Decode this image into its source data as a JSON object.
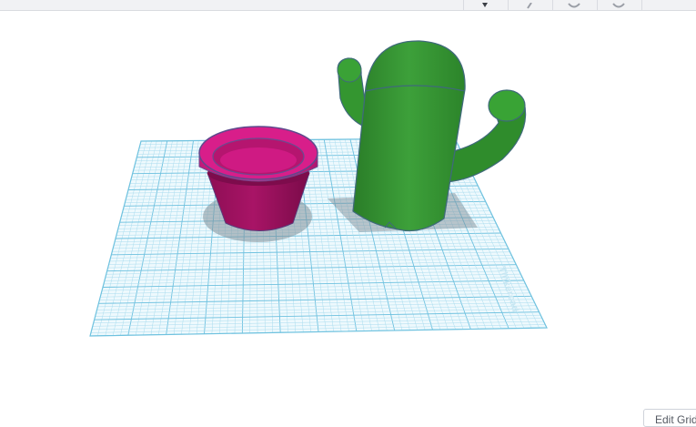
{
  "toolbar": {
    "icons": [
      "pin-icon",
      "slash-tool-icon",
      "rotate-left-icon",
      "rotate-right-icon"
    ]
  },
  "workplane": {
    "watermark": "Tinkercad",
    "grid_color": "#8fd3ea",
    "plane_color": "#e9f7fc"
  },
  "objects": [
    {
      "name": "flower-pot",
      "color": "#c2187a"
    },
    {
      "name": "cactus",
      "color": "#2f8f2c"
    }
  ],
  "footer": {
    "edit_grid_label": "Edit Grid"
  }
}
